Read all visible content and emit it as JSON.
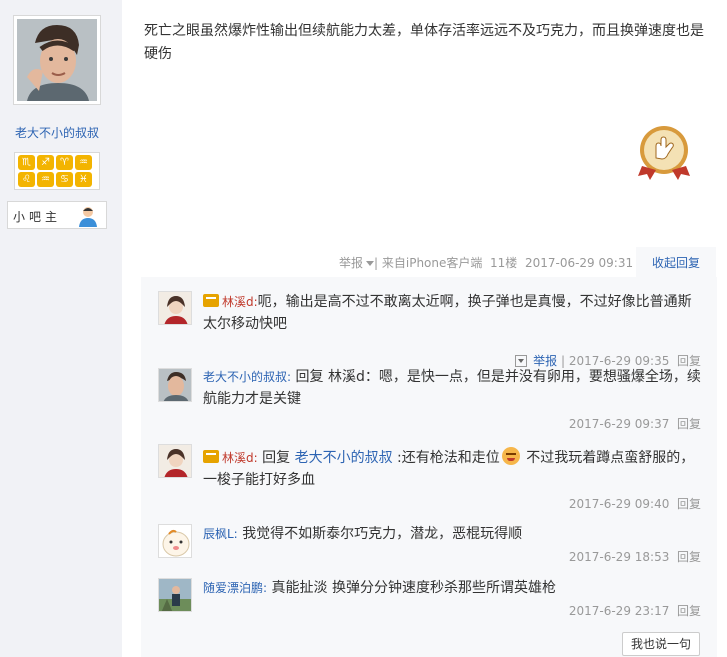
{
  "author": {
    "name": "老大不小的叔叔",
    "zodiac_badges": [
      "♏",
      "♐",
      "♈",
      "♒",
      "♌",
      "♒",
      "♋",
      "♓"
    ],
    "owner_label": "小吧主"
  },
  "post": {
    "text": "死亡之眼虽然爆炸性输出但续航能力太差，单体存活率远远不及巧克力，而且换弹速度也是硬伤",
    "meta": {
      "report": "举报",
      "source_prefix": "| 来自",
      "source": "iPhone客户端",
      "floor": "11楼",
      "datetime": "2017-06-29 09:31"
    },
    "fold_reply": "收起回复"
  },
  "replies": [
    {
      "name": "林溪d:",
      "text": "呃，输出是高不过不敢离太近啊，换子弹也是真慢，不过好像比普通斯太尔移动快吧",
      "report": "举报",
      "sep": "|",
      "time": "2017-6-29 09:35",
      "reply": "回复"
    },
    {
      "name": "老大不小的叔叔:",
      "reply_to_prefix": "回复",
      "reply_to": "林溪d",
      "text": "：嗯，是快一点，但是并没有卵用，要想骚爆全场，续航能力才是关键",
      "time": "2017-6-29 09:37",
      "reply": "回复"
    },
    {
      "name": "林溪d:",
      "reply_to_prefix": "回复",
      "reply_to": "老大不小的叔叔",
      "text_a": ":还有枪法和走位",
      "text_b": "不过我玩着蹲点蛮舒服的，一梭子能打好多血",
      "time": "2017-6-29 09:40",
      "reply": "回复"
    },
    {
      "name": "辰枫L:",
      "text": "我觉得不如斯泰尔巧克力，潜龙，恶棍玩得顺",
      "time": "2017-6-29 18:53",
      "reply": "回复"
    },
    {
      "name": "随爱漂泊鹏:",
      "text": "真能扯淡 换弹分分钟速度秒杀那些所谓英雄枪",
      "time": "2017-6-29 23:17",
      "reply": "回复"
    }
  ],
  "say_button": "我也说一句",
  "colors": {
    "link": "#2d64b3",
    "meta_gray": "#999999",
    "panel_bg": "#f7f8fa",
    "left_bg": "#f1f2f6"
  }
}
